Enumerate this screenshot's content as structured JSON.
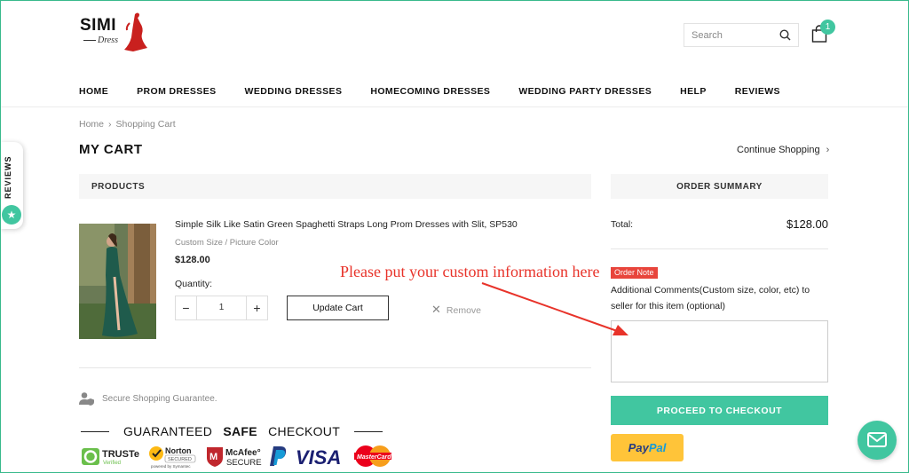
{
  "header": {
    "logo_text": "SIMI",
    "logo_subtext": "Dress",
    "search_placeholder": "Search",
    "cart_count": "1"
  },
  "nav": {
    "items": [
      "HOME",
      "PROM DRESSES",
      "WEDDING DRESSES",
      "HOMECOMING DRESSES",
      "WEDDING PARTY DRESSES",
      "HELP",
      "REVIEWS"
    ]
  },
  "reviews_tab": {
    "label": "REVIEWS"
  },
  "breadcrumb": {
    "home": "Home",
    "current": "Shopping Cart"
  },
  "page": {
    "title": "MY CART",
    "continue_label": "Continue Shopping"
  },
  "products": {
    "header": "PRODUCTS",
    "item": {
      "name": "Simple Silk Like Satin Green Spaghetti Straps Long Prom Dresses with Slit, SP530",
      "variant": "Custom Size / Picture Color",
      "price": "$128.00",
      "quantity_label": "Quantity:",
      "quantity": "1",
      "update_label": "Update Cart",
      "remove_label": "Remove"
    },
    "secure_label": "Secure Shopping Guarantee.",
    "guarantee": {
      "title_prefix": "GUARANTEED ",
      "title_bold": "SAFE",
      "title_suffix": " CHECKOUT",
      "badges": [
        "TRUSTe",
        "Norton",
        "McAfee SECURE",
        "PayPal",
        "VISA",
        "MasterCard"
      ]
    }
  },
  "summary": {
    "header": "ORDER SUMMARY",
    "total_label": "Total:",
    "total_value": "$128.00",
    "note_badge": "Order Note",
    "note_text": "Additional Comments(Custom size, color, etc) to seller for this item (optional)",
    "note_value": "",
    "checkout_label": "PROCEED TO CHECKOUT",
    "paypal_pay": "Pay",
    "paypal_pal": "Pal"
  },
  "annotation": {
    "text": "Please put your custom information here"
  },
  "colors": {
    "accent": "#41c6a0",
    "annotation": "#e8332a",
    "badge": "#e8453c",
    "paypal_yellow": "#ffc439"
  }
}
